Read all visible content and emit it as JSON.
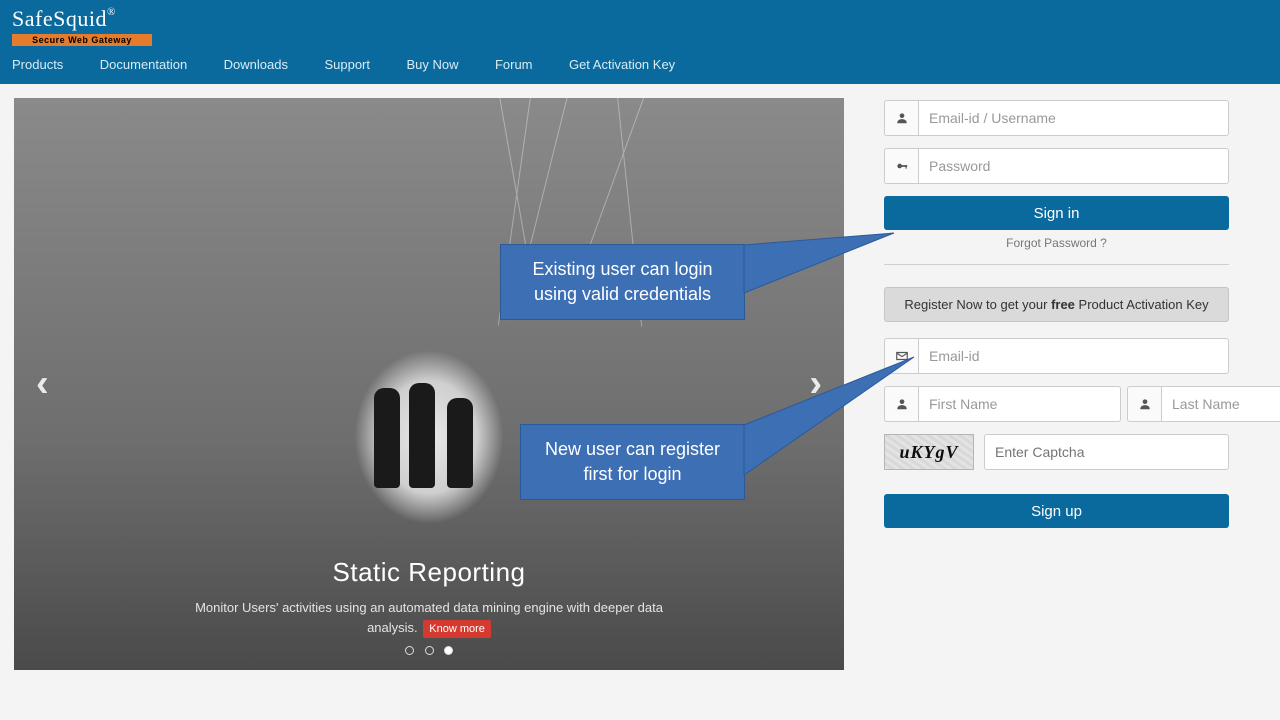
{
  "brand": {
    "name": "SafeSquid",
    "reg": "®",
    "tagline": "Secure Web Gateway"
  },
  "nav": {
    "items": [
      "Products",
      "Documentation",
      "Downloads",
      "Support",
      "Buy Now",
      "Forum",
      "Get Activation Key"
    ]
  },
  "carousel": {
    "title": "Static Reporting",
    "desc": "Monitor Users' activities using an automated data mining engine with deeper data analysis.",
    "know_more": "Know more",
    "active_dot": 2,
    "dot_count": 3
  },
  "login": {
    "username_ph": "Email-id / Username",
    "password_ph": "Password",
    "signin": "Sign in",
    "forgot": "Forgot Password ?"
  },
  "register": {
    "bar_pre": "Register Now to get your ",
    "bar_bold": "free",
    "bar_post": " Product Activation Key",
    "email_ph": "Email-id",
    "first_ph": "First Name",
    "last_ph": "Last Name",
    "captcha_text": "uKYgV",
    "captcha_ph": "Enter Captcha",
    "signup": "Sign up"
  },
  "callouts": {
    "login_note": "Existing user can login using valid credentials",
    "register_note": "New user can register first for login"
  }
}
